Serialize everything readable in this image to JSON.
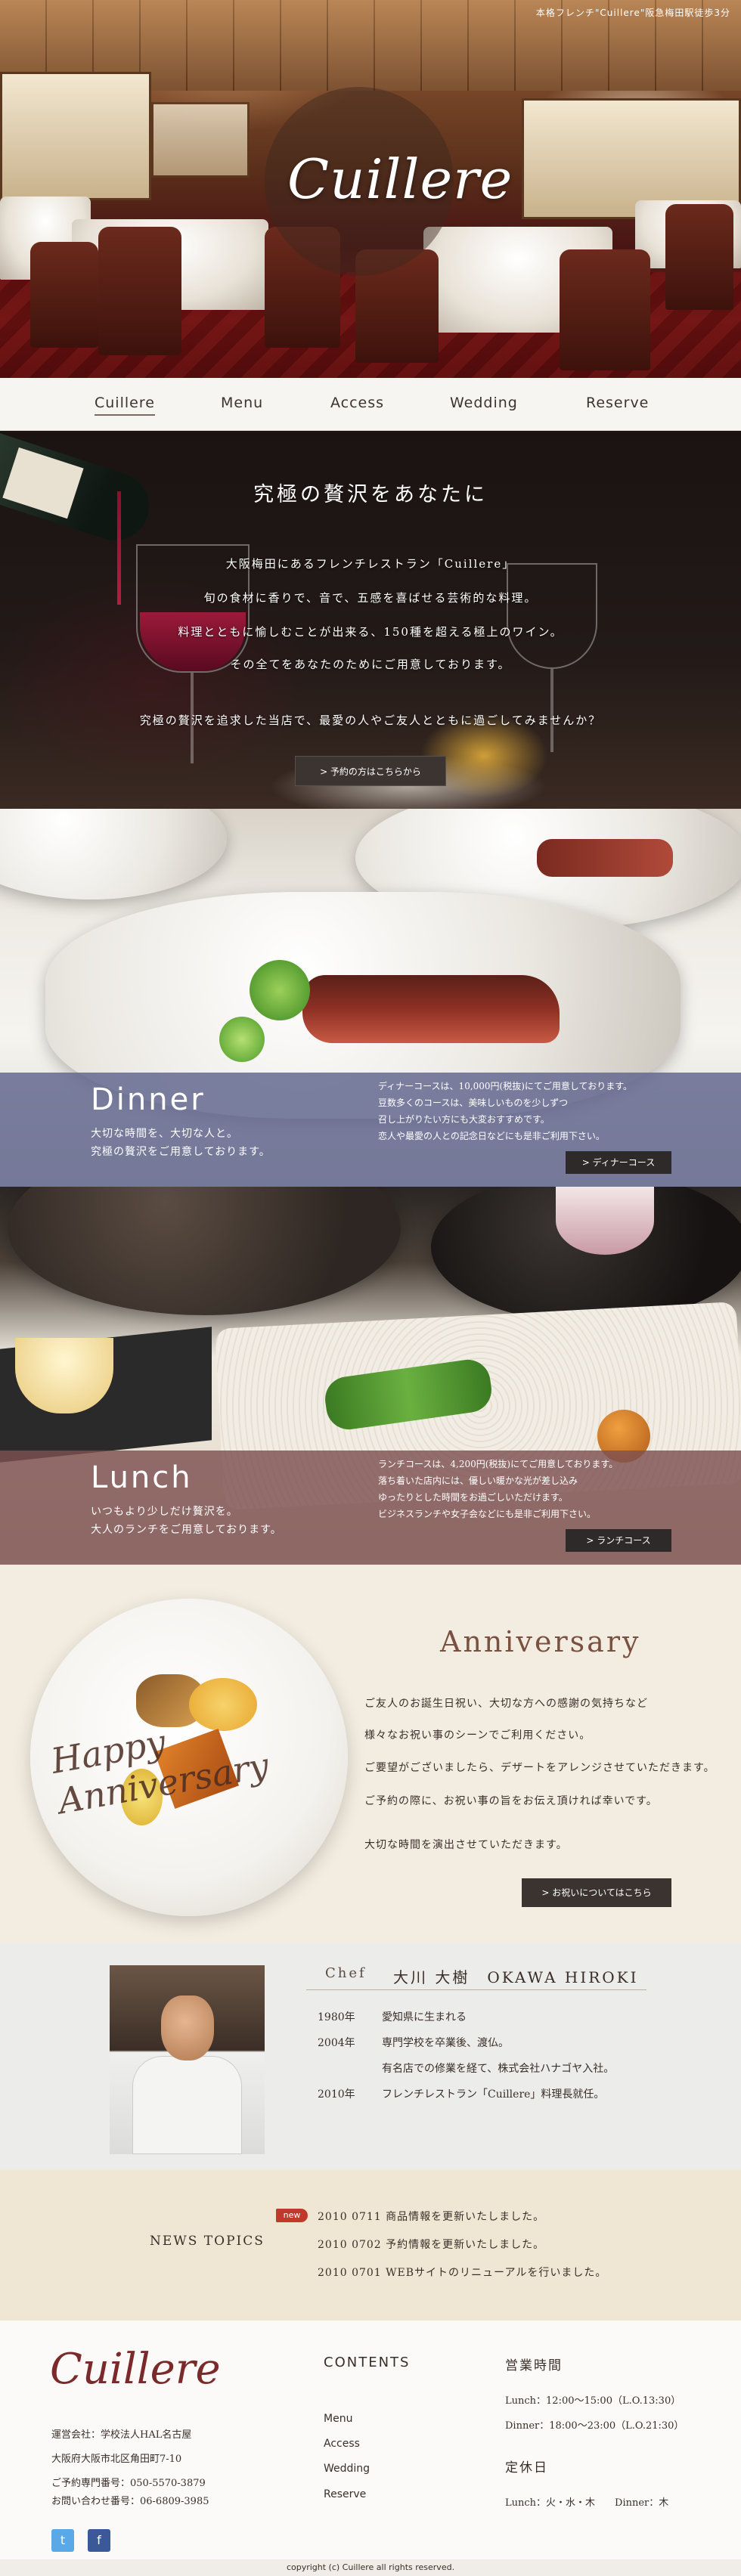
{
  "hero": {
    "tagline": "本格フレンチ\"Cuillere\"阪急梅田駅徒歩3分",
    "logo": "Cuillere"
  },
  "nav": {
    "items": [
      "Cuillere",
      "Menu",
      "Access",
      "Wedding",
      "Reserve"
    ]
  },
  "concept": {
    "heading": "究極の贅沢をあなたに",
    "lines": [
      "大阪梅田にあるフレンチレストラン「Cuillere」",
      "旬の食材に香りで、音で、五感を喜ばせる芸術的な料理。",
      "料理とともに愉しむことが出来る、150種を超える極上のワイン。",
      "その全てをあなたのためにご用意しております。",
      "究極の贅沢を追求した当店で、最愛の人やご友人とともに過ごしてみませんか？"
    ],
    "button": "> 予約の方はこちらから"
  },
  "dinner": {
    "title": "Dinner",
    "sub": [
      "大切な時間を、大切な人と。",
      "究極の贅沢をご用意しております。"
    ],
    "desc": [
      "ディナーコースは、10,000円(税抜)にてご用意しております。",
      "豆数多くのコースは、美味しいものを少しずつ",
      "召し上がりたい方にも大変おすすめです。",
      "恋人や最愛の人との記念日などにも是非ご利用下さい。"
    ],
    "button": "> ディナーコース"
  },
  "lunch": {
    "title": "Lunch",
    "sub": [
      "いつもより少しだけ贅沢を。",
      "大人のランチをご用意しております。"
    ],
    "desc": [
      "ランチコースは、4,200円(税抜)にてご用意しております。",
      "落ち着いた店内には、優しい暖かな光が差し込み",
      "ゆったりとした時間をお過ごしいただけます。",
      "ビジネスランチや女子会などにも是非ご利用下さい。"
    ],
    "button": "> ランチコース"
  },
  "anniversary": {
    "title": "Anniversary",
    "plate_script": "Happy Anniversary",
    "lines": [
      "ご友人のお誕生日祝い、大切な方への感謝の気持ちなど",
      "様々なお祝い事のシーンでご利用ください。",
      "ご要望がございましたら、デザートをアレンジさせていただきます。",
      "ご予約の際に、お祝い事の旨をお伝え頂ければ幸いです。",
      "大切な時間を演出させていただきます。"
    ],
    "button": "> お祝いについてはこちら"
  },
  "chef": {
    "label": "Chef",
    "name": "大川 大樹　OKAWA HIROKI",
    "history": [
      {
        "year": "1980年",
        "text": "愛知県に生まれる"
      },
      {
        "year": "2004年",
        "text": "専門学校を卒業後、渡仏。"
      },
      {
        "year": "",
        "text": "有名店での修業を経て、株式会社ハナゴヤ入社。"
      },
      {
        "year": "2010年",
        "text": "フレンチレストラン「Cuillere」料理長就任。"
      }
    ]
  },
  "news": {
    "heading": "NEWS TOPICS",
    "badge": "new",
    "items": [
      "2010 0711 商品情報を更新いたしました。",
      "2010 0702 予約情報を更新いたしました。",
      "2010 0701 WEBサイトのリニューアルを行いました。"
    ]
  },
  "footer": {
    "logo": "Cuillere",
    "info": [
      "運営会社：学校法人HAL名古屋",
      "大阪府大阪市北区角田町7-10",
      "ご予約専門番号：050-5570-3879",
      "お問い合わせ番号：06-6809-3985"
    ],
    "contents_heading": "CONTENTS",
    "contents": [
      "Menu",
      "Access",
      "Wedding",
      "Reserve"
    ],
    "hours_heading": "営業時間",
    "hours": [
      "Lunch：12:00～15:00（L.O.13:30）",
      "Dinner：18:00～23:00（L.O.21:30）"
    ],
    "closed_heading": "定休日",
    "closed": "Lunch：火・水・木　　Dinner：木",
    "social": [
      {
        "name": "twitter",
        "glyph": "t",
        "color": "#5aa9e6"
      },
      {
        "name": "facebook",
        "glyph": "f",
        "color": "#3b5998"
      }
    ],
    "copyright": "copyright (c) Cuillere all rights reserved."
  }
}
